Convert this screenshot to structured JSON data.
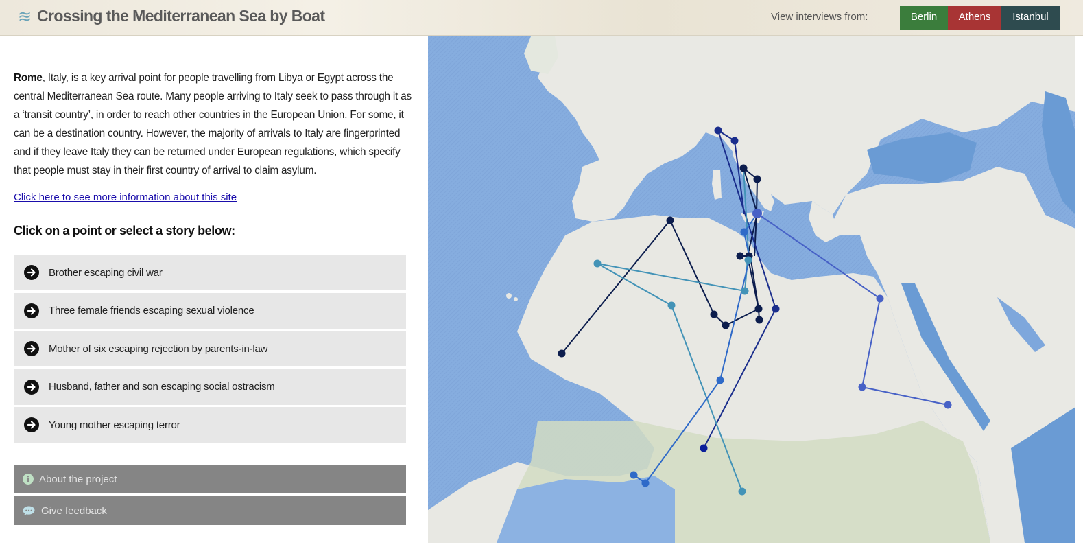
{
  "header": {
    "logo_icon": "wave-icon",
    "logo_glyph": "≋",
    "title": "Crossing the Mediterranean Sea by Boat",
    "view_label": "View interviews from:",
    "cities": [
      {
        "label": "Berlin",
        "color": "#3b7d3c"
      },
      {
        "label": "Athens",
        "color": "#a83434"
      },
      {
        "label": "Istanbul",
        "color": "#2e4b4f"
      }
    ]
  },
  "intro": {
    "city": "Rome",
    "text": ", Italy, is a key arrival point for people travelling from Libya or Egypt across the central Mediterranean Sea route. Many people arriving to Italy seek to pass through it as a ‘transit country’, in order to reach other countries in the European Union. For some, it can be a destination country. However, the majority of arrivals to Italy are fingerprinted and if they leave Italy they can be returned under European regulations, which specify that people must stay in their first country of arrival to claim asylum.",
    "link": "Click here to see more information about this site"
  },
  "stories_heading": "Click on a point or select a story below:",
  "stories": [
    {
      "label": "Brother escaping civil war"
    },
    {
      "label": "Three female friends escaping sexual violence"
    },
    {
      "label": "Mother of six escaping rejection by parents-in-law"
    },
    {
      "label": "Husband, father and son escaping social ostracism"
    },
    {
      "label": "Young mother escaping terror"
    }
  ],
  "buttons": {
    "about": {
      "label": "About the project",
      "icon": "info-icon"
    },
    "feedback": {
      "label": "Give feedback",
      "icon": "speech-bubble-icon"
    }
  },
  "map": {
    "colors": {
      "water_deep": "#6a9bd4",
      "water": "#8fb4e0",
      "land": "#e8e8e3",
      "land_green": "#cdd8c0"
    },
    "routes": [
      {
        "color": "#0c1d4d"
      },
      {
        "color": "#1a2d8c"
      },
      {
        "color": "#4393b7"
      },
      {
        "color": "#2f6ac8"
      },
      {
        "color": "#4761c6"
      }
    ]
  }
}
